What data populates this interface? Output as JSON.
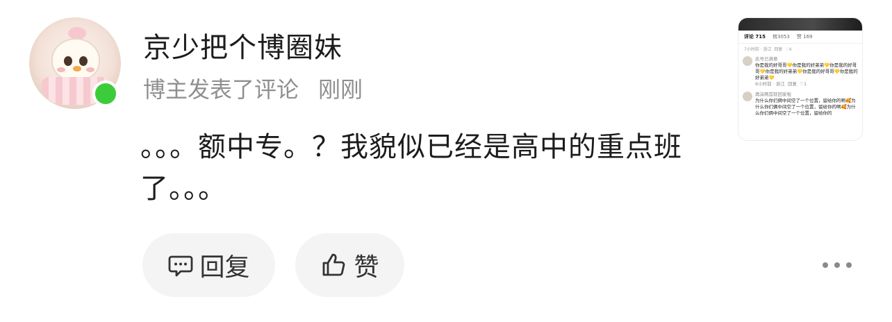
{
  "post": {
    "author": "京少把个博圈妹",
    "meta_label": "博主发表了评论",
    "time": "刚刚",
    "body": "。。。额中专。？我貌似已经是高中的重点班了。。。"
  },
  "actions": {
    "reply_label": "回复",
    "like_label": "赞"
  },
  "thumbnail": {
    "tab_comments": "评论 715",
    "tab_reposts": "转3053",
    "tab_likes": "赞 169",
    "row1_time": "7小时前 · 浙江",
    "row1_reply": "回复",
    "row1_likes": "4",
    "c1_name": "此号已满意",
    "c1_text": "你是我的好哥哥💛你是我的好弟弟💛你是我的好哥哥💛你是我的好弟弟💛你是我的好哥哥💛你是我的好弟弟💛",
    "c1_time": "6小时前 · 浙江",
    "c1_reply": "回复",
    "c1_likes": "1",
    "c2_name": "再演两首就回家啦",
    "c2_text": "为什么你们俩中间空了一个位置，留给你的啊🥰为什么你们俩中间空了一个位置，留给你的啊🥰为什么你们俩中间空了一个位置，留给你的"
  },
  "colors": {
    "online": "#3ccc3b",
    "meta_gray": "#8f8f8f",
    "button_bg": "#f4f4f4"
  }
}
